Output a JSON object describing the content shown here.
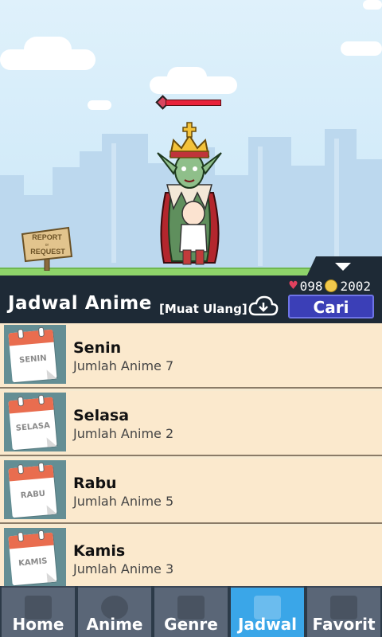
{
  "scene": {
    "sign_text": [
      "REPORT",
      "or",
      "REQUEST"
    ]
  },
  "header": {
    "hearts": "098",
    "coins": "2002",
    "title": "Jadwal Anime",
    "reload_label": "[Muat Ulang]",
    "search_label": "Cari"
  },
  "days": [
    {
      "name": "Senin",
      "count": "Jumlah Anime 7",
      "tag": "SENIN"
    },
    {
      "name": "Selasa",
      "count": "Jumlah Anime 2",
      "tag": "SELASA"
    },
    {
      "name": "Rabu",
      "count": "Jumlah Anime 5",
      "tag": "RABU"
    },
    {
      "name": "Kamis",
      "count": "Jumlah Anime 3",
      "tag": "KAMIS"
    }
  ],
  "nav": [
    {
      "label": "Home",
      "icon": "home-icon"
    },
    {
      "label": "Anime",
      "icon": "anime-icon"
    },
    {
      "label": "Genre",
      "icon": "genre-icon"
    },
    {
      "label": "Jadwal",
      "icon": "calendar-icon"
    },
    {
      "label": "Favorit",
      "icon": "favorite-icon"
    }
  ],
  "colors": {
    "accent": "#3aa6e8",
    "header_bg": "#1e2a36",
    "search_bg": "#3b3fb7",
    "row_bg": "#fbe9cd"
  }
}
